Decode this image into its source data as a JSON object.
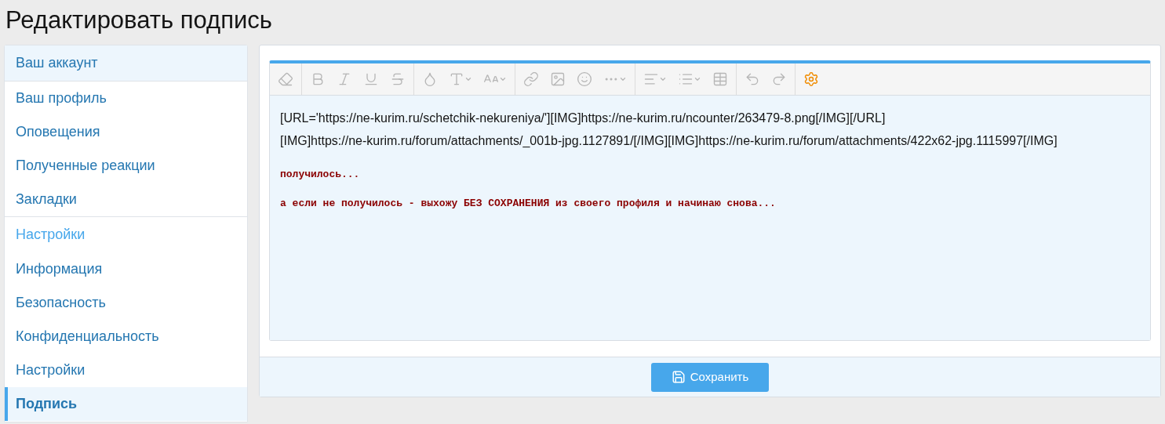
{
  "page_title": "Редактировать подпись",
  "sidebar": {
    "items": [
      {
        "kind": "header",
        "label": "Ваш аккаунт",
        "selected": false
      },
      {
        "kind": "link",
        "label": "Ваш профиль",
        "selected": false
      },
      {
        "kind": "link",
        "label": "Оповещения",
        "selected": false
      },
      {
        "kind": "link",
        "label": "Полученные реакции",
        "selected": false
      },
      {
        "kind": "link",
        "label": "Закладки",
        "selected": false
      },
      {
        "kind": "section",
        "label": "Настройки",
        "selected": false
      },
      {
        "kind": "link",
        "label": "Информация",
        "selected": false
      },
      {
        "kind": "link",
        "label": "Безопасность",
        "selected": false
      },
      {
        "kind": "link",
        "label": "Конфиденциальность",
        "selected": false
      },
      {
        "kind": "link",
        "label": "Настройки",
        "selected": false
      },
      {
        "kind": "link",
        "label": "Подпись",
        "selected": true
      }
    ]
  },
  "editor": {
    "paragraphs": [
      {
        "kind": "bbcode",
        "text": "[URL='https://ne-kurim.ru/schetchik-nekureniya/'][IMG]https://ne-kurim.ru/ncounter/263479-8.png[/IMG][/URL]"
      },
      {
        "kind": "bbcode",
        "text": "[IMG]https://ne-kurim.ru/forum/attachments/_001b-jpg.1127891/[/IMG][IMG]https://ne-kurim.ru/forum/attachments/422x62-jpg.1115997[/IMG]"
      },
      {
        "kind": "mono",
        "text": "получилось..."
      },
      {
        "kind": "mono",
        "text": "а если не получилось - выхожу БЕЗ СОХРАНЕНИЯ из своего профиля и начинаю снова..."
      }
    ]
  },
  "save_button": {
    "label": "Сохранить"
  }
}
